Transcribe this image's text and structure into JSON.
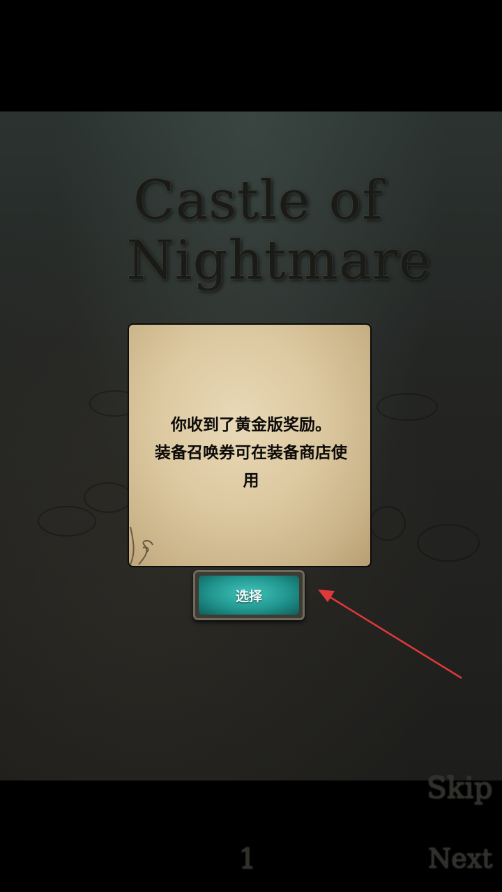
{
  "game": {
    "title_line1": "Castle of",
    "title_line2": "Nightmare"
  },
  "dialog": {
    "message_line1": "你收到了黄金版奖励。",
    "message_line2": "装备召唤券可在装备商店使",
    "message_line3": "用",
    "select_button_label": "选择"
  },
  "footer": {
    "skip_label": "Skip",
    "page_number": "1",
    "next_label": "Next"
  },
  "annotation": {
    "arrow_color": "#e0393a"
  },
  "colors": {
    "button_teal": "#21968f",
    "parchment": "#dcc8a0"
  }
}
